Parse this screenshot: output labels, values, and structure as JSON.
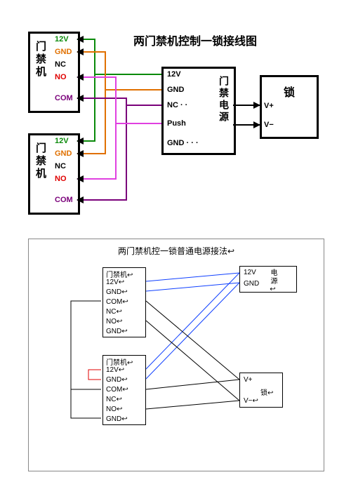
{
  "diagram1": {
    "title": "两门禁机控制一锁接线图",
    "access1": {
      "label": "门禁机",
      "pins": {
        "v12": "12V",
        "gnd": "GND",
        "nc": "NC",
        "no": "NO",
        "com": "COM"
      }
    },
    "access2": {
      "label": "门禁机",
      "pins": {
        "v12": "12V",
        "gnd": "GND",
        "nc": "NC",
        "no": "NO",
        "com": "COM"
      }
    },
    "psu": {
      "label": "门禁电源",
      "pins": {
        "v12": "12V",
        "gnd": "GND",
        "nc": "NC · ·",
        "push": "Push",
        "gnd2": "GND · · ·"
      }
    },
    "lock": {
      "label": "锁",
      "pins": {
        "vp": "V+",
        "vn": "V−"
      }
    }
  },
  "diagram2": {
    "title": "两门禁机控一锁普通电源接法↩",
    "access1": {
      "label": "门禁机↩",
      "pins": {
        "v12": "12V↩",
        "gnd": "GND↩",
        "com": "COM↩",
        "nc": "NC↩",
        "no": "NO↩",
        "gnd2": "GND↩"
      }
    },
    "access2": {
      "label": "门禁机↩",
      "pins": {
        "v12": "12V↩",
        "gnd": "GND↩",
        "com": "COM↩",
        "nc": "NC↩",
        "no": "NO↩",
        "gnd2": "GND↩"
      }
    },
    "psu": {
      "label": "电源↩",
      "pins": {
        "v12": "12V",
        "gnd": "GND"
      }
    },
    "lock": {
      "label": "锁↩",
      "pins": {
        "vp": "V+",
        "vn": "V−↩"
      }
    }
  }
}
